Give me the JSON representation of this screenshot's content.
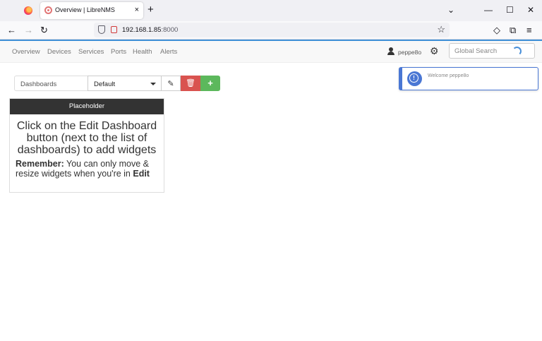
{
  "browser": {
    "tab_title": "Overview | LibreNMS",
    "url_host": "192.168.1.85",
    "url_port": ":8000",
    "tab_close": "×",
    "new_tab": "+",
    "minimize": "—",
    "maximize": "☐",
    "close": "✕",
    "back": "←",
    "forward": "→",
    "reload": "↻",
    "star": "☆",
    "pocket": "◇",
    "extensions": "⧉",
    "menu": "≡"
  },
  "nav": {
    "items": [
      "Overview",
      "Devices",
      "Services",
      "Ports",
      "Health",
      "Alerts"
    ],
    "username": "peppe8o",
    "search_placeholder": "Global Search",
    "gear": "⚙"
  },
  "toast": {
    "message": "Welcome peppe8o"
  },
  "dashboard": {
    "label": "Dashboards",
    "selected": "Default",
    "edit_icon": "✎",
    "delete_icon": "🗑",
    "add_icon": "+"
  },
  "widget": {
    "title": "Placeholder",
    "main_text": "Click on the Edit Dashboard button (next to the list of dashboards) to add widgets",
    "remember_label": "Remember:",
    "remember_text": " You can only move & resize widgets when you're in ",
    "edit_word": "Edit"
  },
  "colors": {
    "accent_blue": "#3f8fd6",
    "danger": "#d9534f",
    "success": "#5cb85c",
    "toast_border": "#4a77d4",
    "widget_header": "#333333"
  }
}
